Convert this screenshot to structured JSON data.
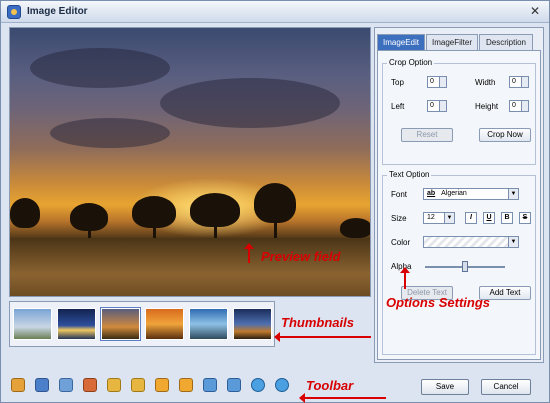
{
  "window": {
    "title": "Image Editor",
    "close_glyph": "✕"
  },
  "annotations": {
    "preview": "Preview field",
    "thumbnails": "Thumbnails",
    "options": "Options Settings",
    "toolbar": "Toolbar"
  },
  "tabs": [
    {
      "label": "ImageEdit",
      "active": true
    },
    {
      "label": "ImageFilter",
      "active": false
    },
    {
      "label": "Description",
      "active": false
    }
  ],
  "crop": {
    "title": "Crop Option",
    "top_label": "Top",
    "top_value": "0",
    "width_label": "Width",
    "width_value": "0",
    "left_label": "Left",
    "left_value": "0",
    "height_label": "Height",
    "height_value": "0",
    "reset_label": "Reset",
    "crop_now_label": "Crop Now"
  },
  "text_option": {
    "title": "Text Option",
    "font_label": "Font",
    "font_value": "Algerian",
    "font_prefix": "ab",
    "size_label": "Size",
    "size_value": "12",
    "italic": "I",
    "underline": "U",
    "bold": "B",
    "strike": "S",
    "color_label": "Color",
    "alpha_label": "Alpha",
    "alpha_level": 0.5,
    "delete_label": "Delete Text",
    "add_label": "Add Text"
  },
  "footer": {
    "save_label": "Save",
    "cancel_label": "Cancel"
  },
  "icons": {
    "toolbar": [
      "open-icon",
      "save-icon",
      "crop-icon",
      "resize-icon",
      "rotate-left-icon",
      "rotate-right-icon",
      "flip-horizontal-icon",
      "flip-vertical-icon",
      "previous-icon",
      "next-icon",
      "zoom-in-icon",
      "zoom-out-icon"
    ],
    "colors": {
      "annotation": "#d80000",
      "active_tab": "#3d6fbf"
    }
  }
}
